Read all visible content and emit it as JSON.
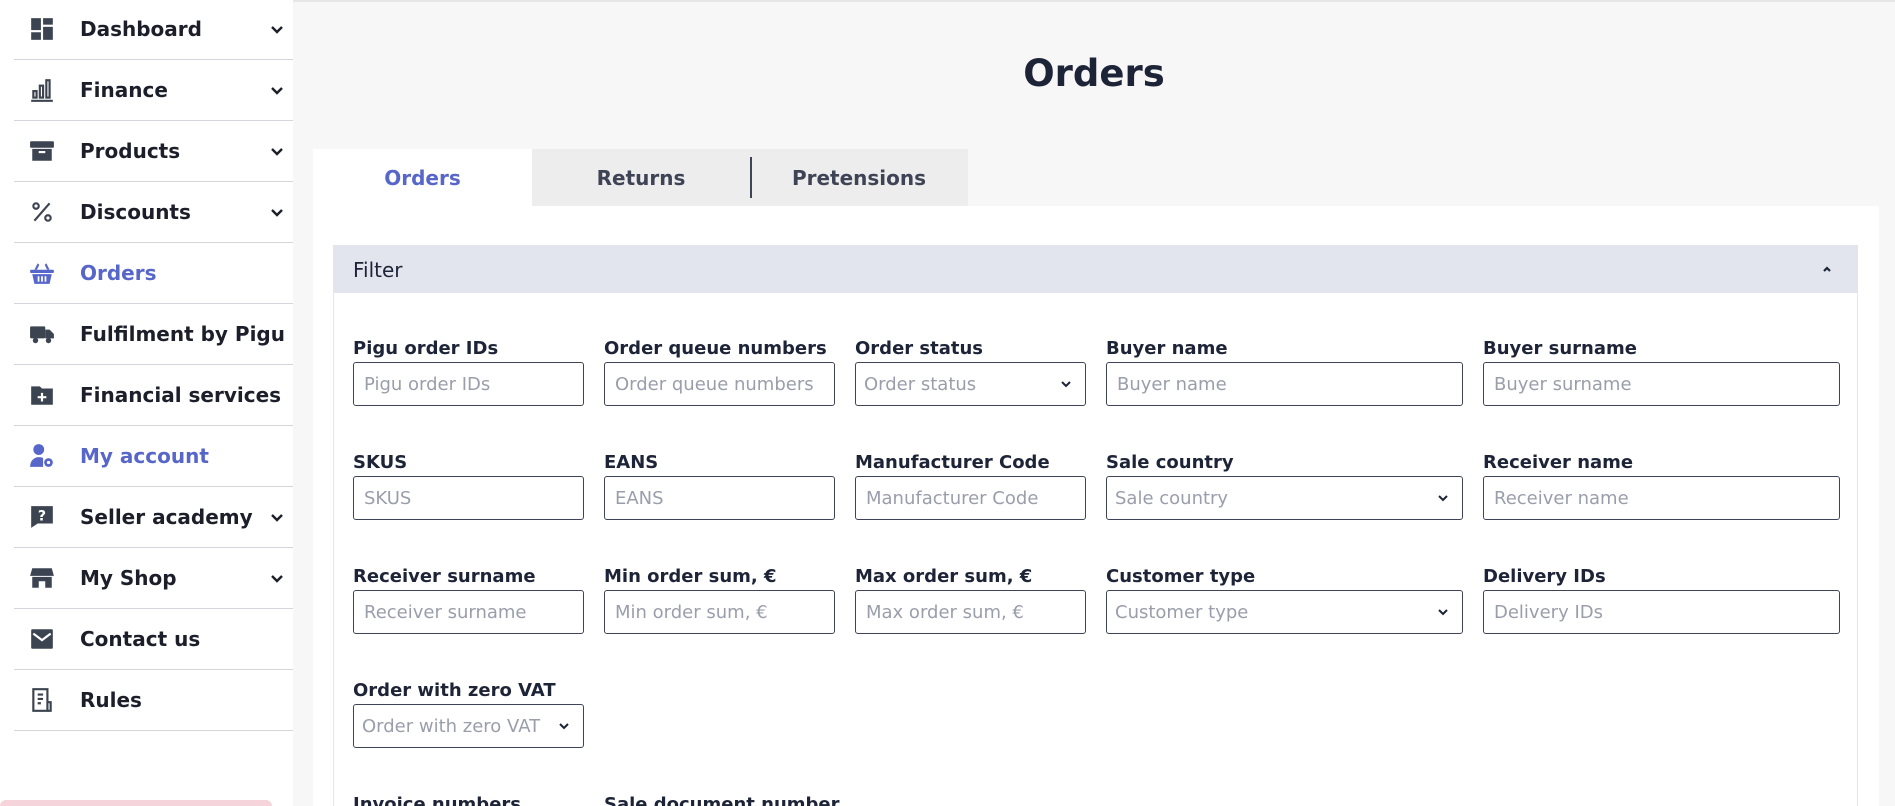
{
  "sidebar": {
    "items": [
      {
        "label": "Dashboard",
        "icon": "dashboard-icon",
        "has_chevron": true,
        "active": false
      },
      {
        "label": "Finance",
        "icon": "finance-chart-icon",
        "has_chevron": true,
        "active": false
      },
      {
        "label": "Products",
        "icon": "archive-box-icon",
        "has_chevron": true,
        "active": false
      },
      {
        "label": "Discounts",
        "icon": "percent-icon",
        "has_chevron": true,
        "active": false
      },
      {
        "label": "Orders",
        "icon": "basket-icon",
        "has_chevron": false,
        "active": true
      },
      {
        "label": "Fulfilment by Pigu",
        "icon": "truck-icon",
        "has_chevron": false,
        "active": false
      },
      {
        "label": "Financial services",
        "icon": "folder-plus-icon",
        "has_chevron": false,
        "active": false
      },
      {
        "label": "My account",
        "icon": "user-gear-icon",
        "has_chevron": false,
        "active": true
      },
      {
        "label": "Seller academy",
        "icon": "question-chat-icon",
        "has_chevron": true,
        "active": false
      },
      {
        "label": "My Shop",
        "icon": "shop-icon",
        "has_chevron": true,
        "active": false
      },
      {
        "label": "Contact us",
        "icon": "envelope-icon",
        "has_chevron": false,
        "active": false
      },
      {
        "label": "Rules",
        "icon": "document-list-icon",
        "has_chevron": false,
        "active": false
      }
    ]
  },
  "page": {
    "title": "Orders"
  },
  "tabs": [
    {
      "label": "Orders",
      "active": true
    },
    {
      "label": "Returns",
      "active": false
    },
    {
      "label": "Pretensions",
      "active": false
    }
  ],
  "filter": {
    "title": "Filter",
    "fields": {
      "pigu_order_ids": {
        "label": "Pigu order IDs",
        "placeholder": "Pigu order IDs"
      },
      "order_queue_numbers": {
        "label": "Order queue numbers",
        "placeholder": "Order queue numbers"
      },
      "order_status": {
        "label": "Order status",
        "placeholder": "Order status"
      },
      "buyer_name": {
        "label": "Buyer name",
        "placeholder": "Buyer name"
      },
      "buyer_surname": {
        "label": "Buyer surname",
        "placeholder": "Buyer surname"
      },
      "skus": {
        "label": "SKUS",
        "placeholder": "SKUS"
      },
      "eans": {
        "label": "EANS",
        "placeholder": "EANS"
      },
      "manufacturer_code": {
        "label": "Manufacturer Code",
        "placeholder": "Manufacturer Code"
      },
      "sale_country": {
        "label": "Sale country",
        "placeholder": "Sale country"
      },
      "receiver_name": {
        "label": "Receiver name",
        "placeholder": "Receiver name"
      },
      "receiver_surname": {
        "label": "Receiver surname",
        "placeholder": "Receiver surname"
      },
      "min_order_sum": {
        "label": "Min order sum, €",
        "placeholder": "Min order sum, €"
      },
      "max_order_sum": {
        "label": "Max order sum, €",
        "placeholder": "Max order sum, €"
      },
      "customer_type": {
        "label": "Customer type",
        "placeholder": "Customer type"
      },
      "delivery_ids": {
        "label": "Delivery IDs",
        "placeholder": "Delivery IDs"
      },
      "order_zero_vat": {
        "label": "Order with zero VAT",
        "placeholder": "Order with zero VAT"
      },
      "invoice_numbers": {
        "label": "Invoice numbers"
      },
      "sale_document_number": {
        "label": "Sale document number"
      }
    }
  }
}
